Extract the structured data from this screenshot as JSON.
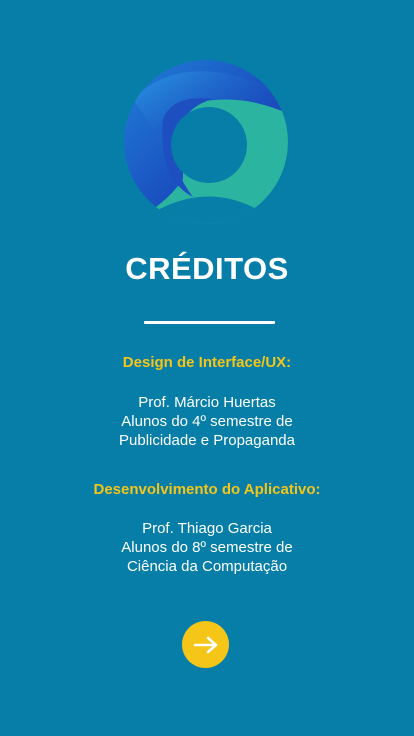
{
  "title": "CRÉDITOS",
  "sections": [
    {
      "heading": "Design de Interface/UX:",
      "lines": [
        "Prof. Márcio Huertas",
        "Alunos do 4º semestre de",
        "Publicidade e Propaganda"
      ]
    },
    {
      "heading": "Desenvolvimento do Aplicativo:",
      "lines": [
        "Prof. Thiago Garcia",
        "Alunos do 8º semestre de",
        "Ciência da Computação"
      ]
    }
  ],
  "icons": {
    "logo": "user-avatar-logo-icon",
    "next": "arrow-right-icon"
  },
  "colors": {
    "background": "#067ea8",
    "accent": "#f5c518",
    "logo_teal": "#2bb5a0",
    "logo_blue": "#1a5bc4"
  }
}
